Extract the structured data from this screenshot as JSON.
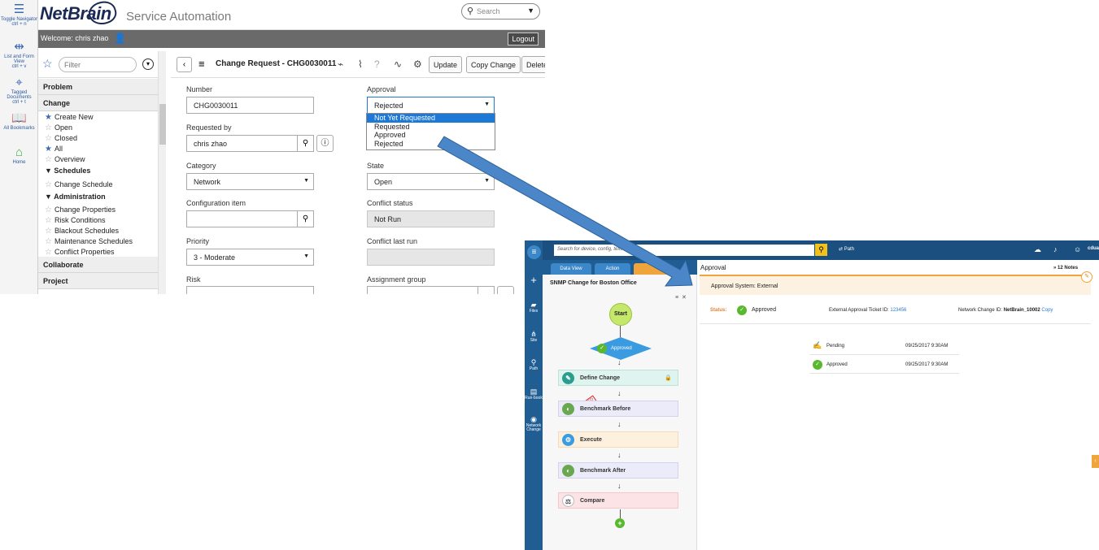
{
  "servicenow": {
    "rail": [
      {
        "label": "Toggle Navigator",
        "shortcut": "ctrl + n",
        "icon": "list-icon"
      },
      {
        "label": "List and Form View",
        "shortcut": "ctrl + v",
        "icon": "arrows-icon"
      },
      {
        "label": "Tagged Documents",
        "shortcut": "ctrl + t",
        "icon": "tag-icon"
      },
      {
        "label": "All Bookmarks",
        "icon": "book-icon"
      },
      {
        "label": "Home",
        "icon": "home-icon"
      }
    ],
    "brand": {
      "logo": "NetBrain",
      "title": "Service Automation"
    },
    "search": {
      "placeholder": "Search"
    },
    "welcome": {
      "text": "Welcome:  chris zhao",
      "logout": "Logout"
    },
    "filter": {
      "placeholder": "Filter"
    },
    "nav": {
      "sections": [
        "Problem",
        "Change",
        "Collaborate",
        "Project"
      ],
      "change_items": [
        {
          "label": "Create New",
          "starred": true
        },
        {
          "label": "Open",
          "starred": false
        },
        {
          "label": "Closed",
          "starred": false
        },
        {
          "label": "All",
          "starred": true
        },
        {
          "label": "Overview",
          "starred": false
        }
      ],
      "schedules_label": "Schedules",
      "schedules_items": [
        {
          "label": "Change Schedule",
          "starred": false
        }
      ],
      "administration_label": "Administration",
      "administration_items": [
        {
          "label": "Change Properties",
          "starred": false
        },
        {
          "label": "Risk Conditions",
          "starred": false
        },
        {
          "label": "Blackout Schedules",
          "starred": false
        },
        {
          "label": "Maintenance Schedules",
          "starred": false
        },
        {
          "label": "Conflict Properties",
          "starred": false
        }
      ]
    },
    "form": {
      "title": "Change Request - CHG0030011",
      "buttons": {
        "update": "Update",
        "copy": "Copy Change",
        "delete": "Delete"
      },
      "number_label": "Number",
      "number_value": "CHG0030011",
      "approval_label": "Approval",
      "approval_value": "Rejected",
      "approval_options": [
        "Not Yet Requested",
        "Requested",
        "Approved",
        "Rejected"
      ],
      "requested_by_label": "Requested by",
      "requested_by_value": "chris zhao",
      "category_label": "Category",
      "category_value": "Network",
      "state_label": "State",
      "state_value": "Open",
      "config_item_label": "Configuration item",
      "config_item_value": "",
      "conflict_status_label": "Conflict status",
      "conflict_status_value": "Not Run",
      "priority_label": "Priority",
      "priority_value": "3 - Moderate",
      "conflict_last_run_label": "Conflict last run",
      "conflict_last_run_value": "",
      "risk_label": "Risk",
      "assignment_group_label": "Assignment group"
    }
  },
  "netbrain": {
    "search_placeholder": "Search for device, config, text...",
    "path_label": "Path",
    "user": "cdua",
    "side": [
      "Files",
      "Site",
      "Path",
      "Run-book",
      "Network Change"
    ],
    "tabs": [
      "Data View",
      "Action"
    ],
    "left_title": "SNMP Change for Boston Office",
    "workflow": {
      "start": "Start",
      "approved": "Approved",
      "stamp": "APPROVED",
      "steps": [
        "Define Change",
        "Benchmark Before",
        "Execute",
        "Benchmark After",
        "Compare"
      ]
    },
    "right_title": "Approval",
    "notes": "12 Notes",
    "approval_system": "Approval System:  External",
    "status_label": "Status:",
    "status_value": "Approved",
    "ticket_label": "External Approval Ticket ID:",
    "ticket_value": "123456",
    "change_id_label": "Network Change ID:",
    "change_id_value": "NetBrain_10002",
    "copy": "Copy",
    "history": [
      {
        "name": "Pending",
        "time": "09/25/2017 9:30AM"
      },
      {
        "name": "Approved",
        "time": "09/25/2017 9:30AM"
      }
    ]
  },
  "colors": {
    "arrow": "#4a86c8",
    "netbrain_blue": "#1f5d93",
    "accent_orange": "#f0a53c",
    "approved_green": "#5ab82f",
    "selected_option": "#1e78d6"
  }
}
